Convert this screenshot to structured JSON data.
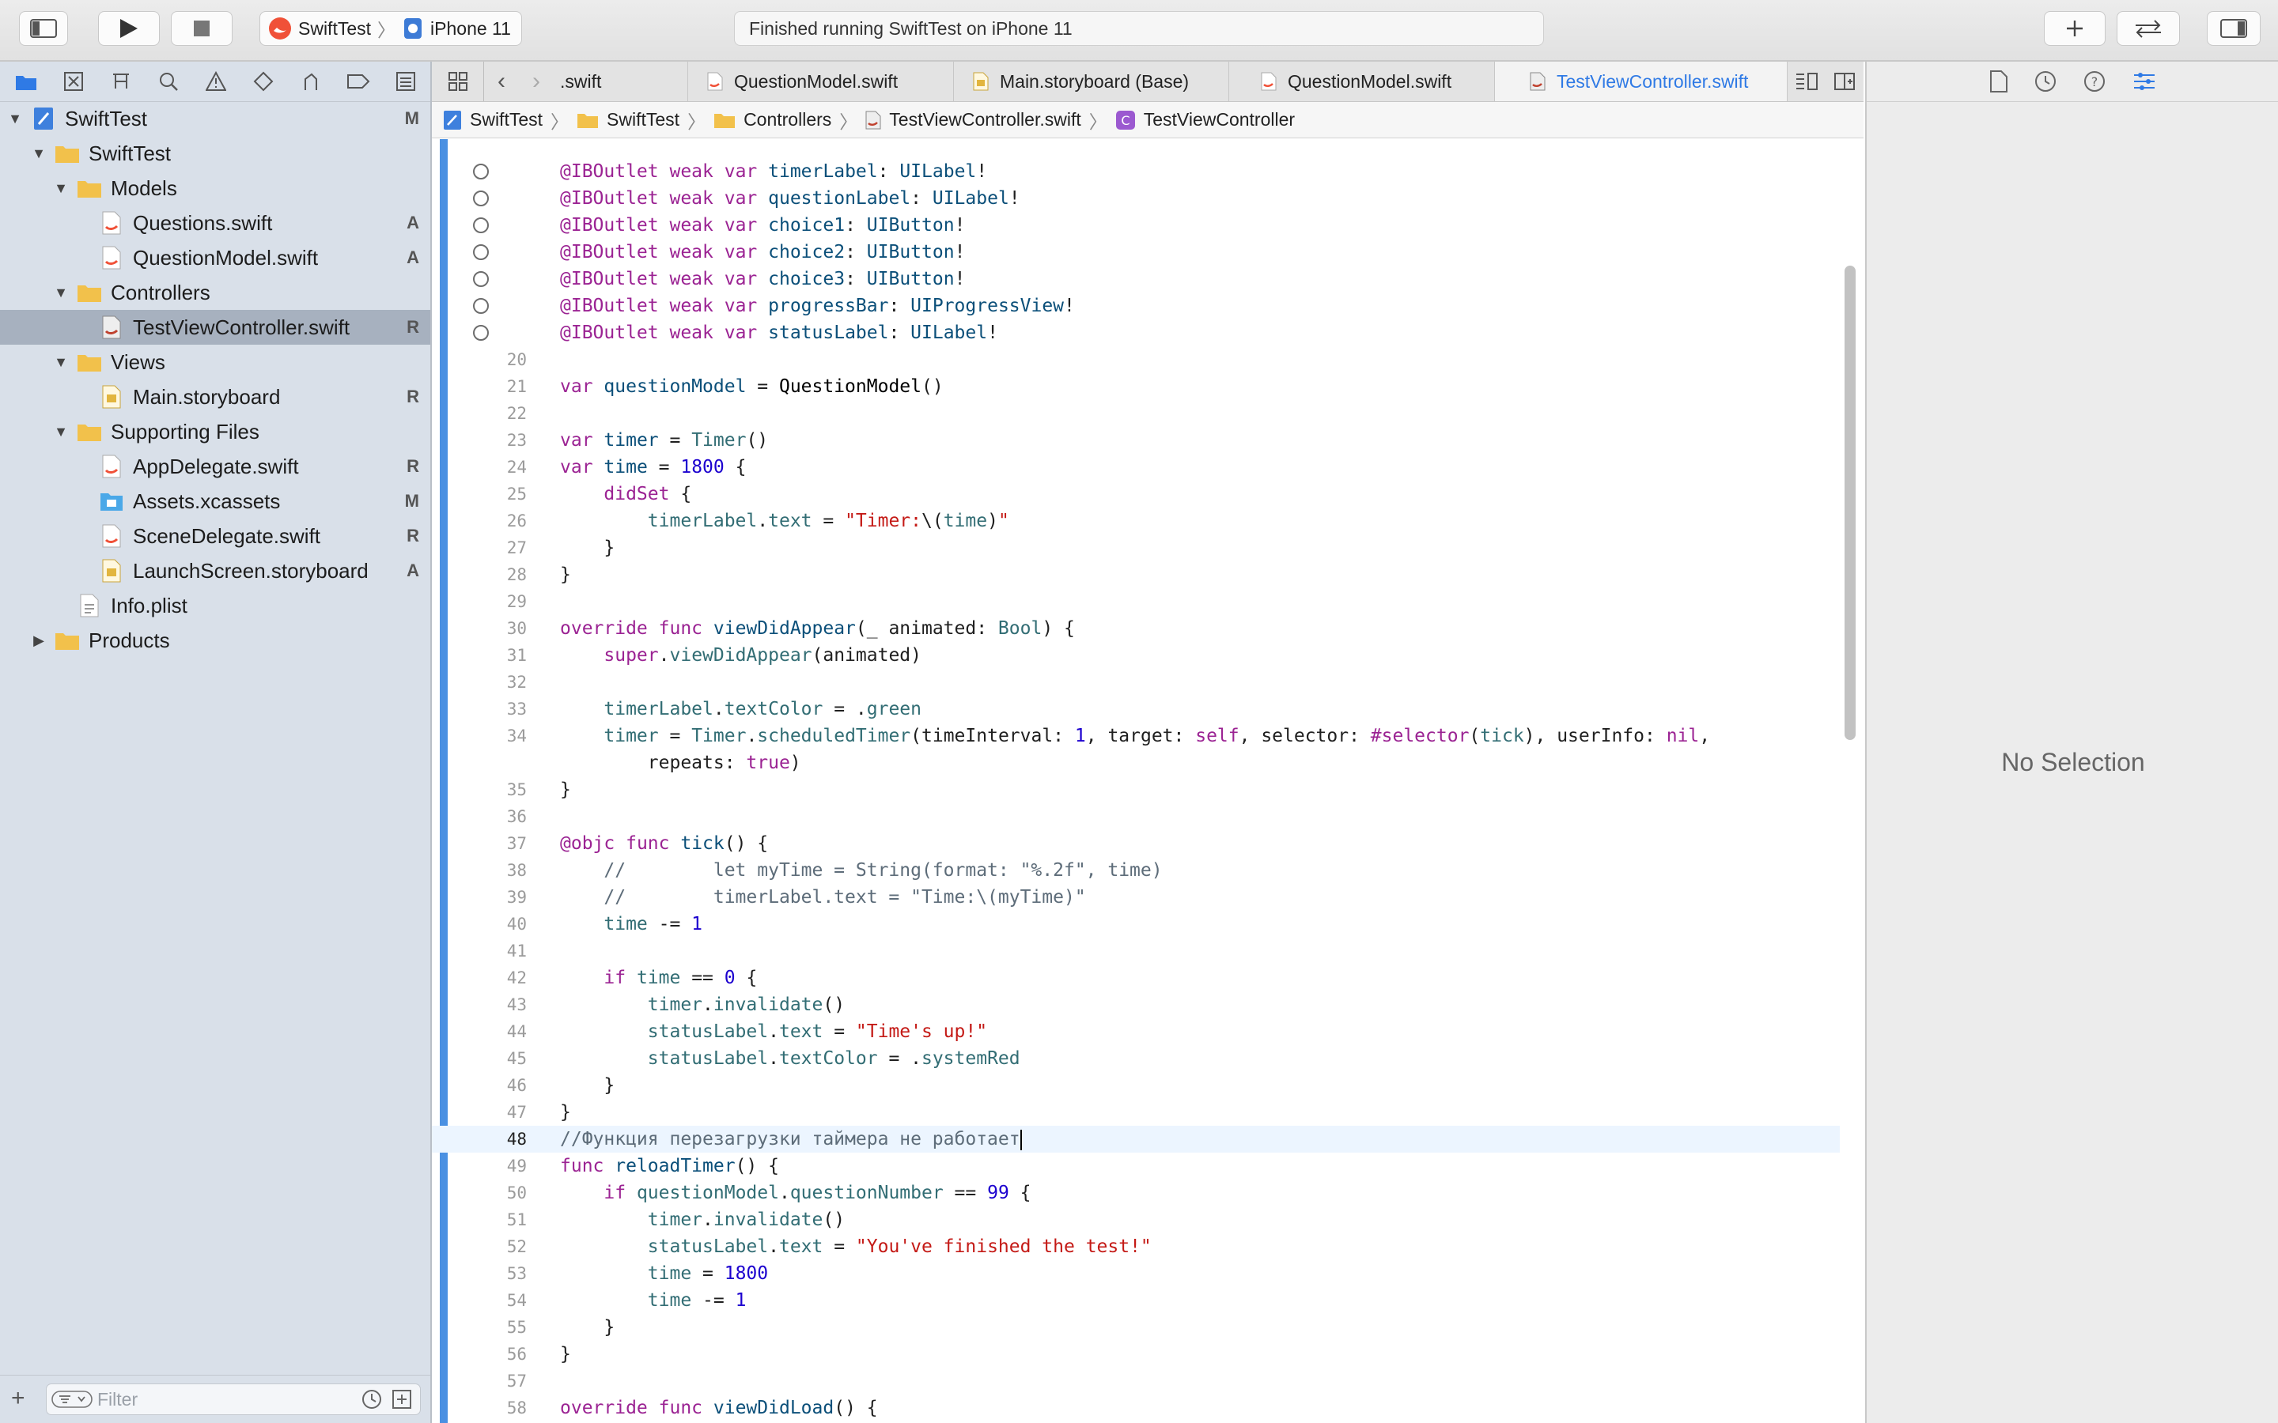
{
  "toolbar": {
    "scheme_project": "SwiftTest",
    "scheme_device": "iPhone 11",
    "status_text": "Finished running SwiftTest on iPhone 11"
  },
  "tabs": [
    {
      "label": ".swift"
    },
    {
      "label": "QuestionModel.swift"
    },
    {
      "label": "Main.storyboard (Base)"
    },
    {
      "label": "QuestionModel.swift"
    },
    {
      "label": "TestViewController.swift",
      "active": true
    }
  ],
  "jumpbar": [
    "SwiftTest",
    "SwiftTest",
    "Controllers",
    "TestViewController.swift",
    "TestViewController"
  ],
  "navigator": {
    "items": [
      {
        "label": "SwiftTest",
        "badge": "M"
      },
      {
        "label": "SwiftTest",
        "badge": ""
      },
      {
        "label": "Models",
        "badge": ""
      },
      {
        "label": "Questions.swift",
        "badge": "A"
      },
      {
        "label": "QuestionModel.swift",
        "badge": "A"
      },
      {
        "label": "Controllers",
        "badge": ""
      },
      {
        "label": "TestViewController.swift",
        "badge": "R"
      },
      {
        "label": "Views",
        "badge": ""
      },
      {
        "label": "Main.storyboard",
        "badge": "R"
      },
      {
        "label": "Supporting Files",
        "badge": ""
      },
      {
        "label": "AppDelegate.swift",
        "badge": "R"
      },
      {
        "label": "Assets.xcassets",
        "badge": "M"
      },
      {
        "label": "SceneDelegate.swift",
        "badge": "R"
      },
      {
        "label": "LaunchScreen.storyboard",
        "badge": "A"
      },
      {
        "label": "Info.plist",
        "badge": ""
      },
      {
        "label": "Products",
        "badge": ""
      }
    ],
    "filter_placeholder": "Filter"
  },
  "editor": {
    "line_numbers": [
      "",
      "",
      "",
      "",
      "",
      "",
      "",
      "20",
      "21",
      "22",
      "23",
      "24",
      "25",
      "26",
      "27",
      "28",
      "29",
      "30",
      "31",
      "32",
      "33",
      "34",
      "",
      "35",
      "36",
      "37",
      "38",
      "39",
      "40",
      "41",
      "42",
      "43",
      "44",
      "45",
      "46",
      "47",
      "48",
      "49",
      "50",
      "51",
      "52",
      "53",
      "54",
      "55",
      "56",
      "57",
      "58"
    ]
  },
  "inspector": {
    "no_selection": "No Selection"
  },
  "colors": {
    "keyword": "#9b2393",
    "type": "#0b4f79",
    "property": "#326d74",
    "string": "#c41a16",
    "number": "#1c00cf",
    "comment": "#5d6c79",
    "accent": "#2f7ae5"
  }
}
